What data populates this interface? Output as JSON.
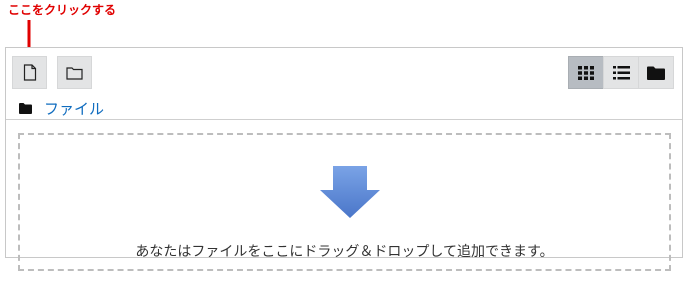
{
  "annotation": {
    "label": "ここをクリックする"
  },
  "toolbar": {
    "add_file_icon": "file-icon",
    "create_folder_icon": "folder-icon",
    "views": [
      {
        "icon": "grid-icon",
        "active": true
      },
      {
        "icon": "list-icon",
        "active": false
      },
      {
        "icon": "folder-tree-icon",
        "active": false
      }
    ]
  },
  "breadcrumb": {
    "icon": "folder-icon",
    "label": "ファイル"
  },
  "dropzone": {
    "icon": "down-arrow-icon",
    "text": "あなたはファイルをここにドラッグ＆ドロップして追加できます。"
  },
  "colors": {
    "annotation": "#e00000",
    "link": "#0f6cbf",
    "arrow": "#5b86d6",
    "active_view": "#b7bcc2"
  }
}
